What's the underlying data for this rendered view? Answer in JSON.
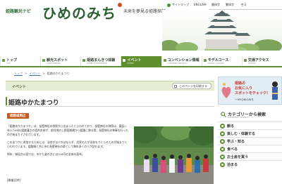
{
  "header": {
    "logo_sub": "姫路観光ナビ",
    "logo_main": "ひめのみち",
    "tagline": "未来を夢見る姫路探訪",
    "util": {
      "sitemap": "サイトマップ",
      "english": "ENGLISH",
      "lang2": "簡体字",
      "lang3": "繁体字",
      "lang4": "한국"
    },
    "fontsize": {
      "label": "文字サイズ",
      "small": "標準",
      "large": "拡大"
    }
  },
  "nav": {
    "items": [
      {
        "jp": "トップ",
        "en": "TOP"
      },
      {
        "jp": "観光スポット",
        "en": "SIGHTSEEING"
      },
      {
        "jp": "姫路まんきつ体験",
        "en": "HIMEJI EXPERIENCE"
      },
      {
        "jp": "イベント",
        "en": "EVENT",
        "active": true
      },
      {
        "jp": "コンベンション情報",
        "en": "CONVENTION INFO"
      },
      {
        "jp": "モデルコース",
        "en": "MODEL COURSE"
      },
      {
        "jp": "交通アクセス",
        "en": "ACCESS"
      }
    ]
  },
  "breadcrumb": {
    "home": "トップ",
    "sep": ">",
    "parent": "イベント",
    "current": "姫路ゆかたまつり"
  },
  "section": {
    "label": "イベント",
    "share_button": "このページを印刷する"
  },
  "article": {
    "title": "姫路ゆかたまつり",
    "area_badge": "姫路城周辺",
    "paragraphs": [
      "「姫路ゆかたまつり」は、長壁神社の例祭から広まったといわれており、長壁神社の例祭は、寛延二年(1749年)姫路藩主の酒井忠恭が、前任地の上野国前橋から姫路に移る際、長壁神社の神事を行ったのが始まりとされています。",
      "このまつりに参加するためには、浴衣がなければならず、武家の人が浴衣をつくらせたのが始まりといわれています。姫路城と共に歩む長壁神社の祭として毎年多くの人が訪れます。",
      "例年、城見台公園では、ゆかた姿の方には100円の金券を配布。"
    ],
    "date_heading": "[開催日時]"
  },
  "sidebar": {
    "banner": {
      "line1": "姫路の",
      "line2": "お気に入り",
      "line3": "スポットをチェック!",
      "line4": "→ MYひめのみち"
    },
    "category": {
      "title": "カテゴリーから検索",
      "subtitle": "CATEGORY SEARCH",
      "items": [
        {
          "label": "観る"
        },
        {
          "label": "楽しむ・体験する"
        },
        {
          "label": "学ぶ・知る"
        },
        {
          "label": "食べる"
        },
        {
          "label": "お土産を買う"
        },
        {
          "label": "泊まる"
        }
      ]
    }
  }
}
